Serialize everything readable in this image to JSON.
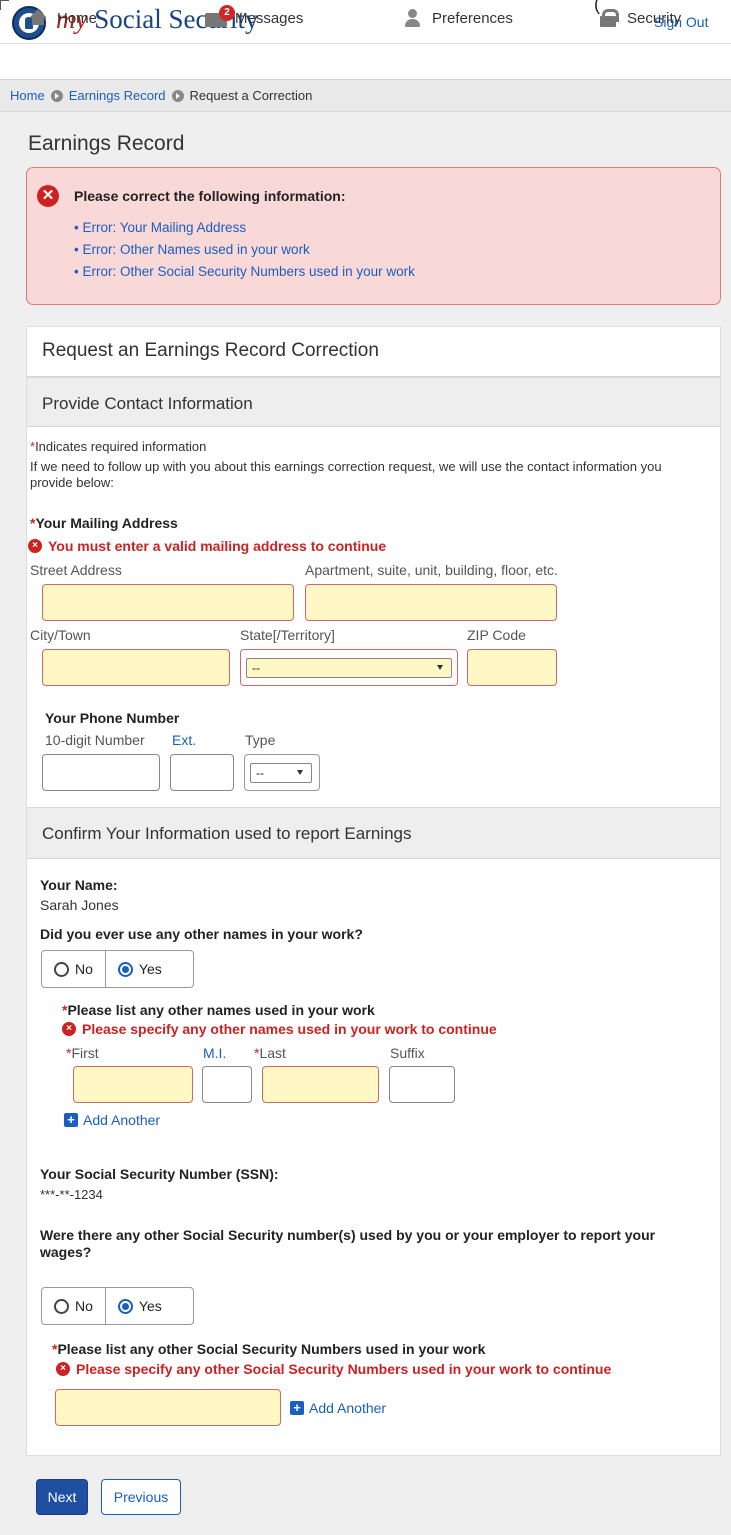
{
  "header": {
    "brand_my": "my",
    "brand_rest": " Social Security",
    "paren": "(",
    "sign_out": "Sign Out",
    "nav": {
      "home": "Home",
      "messages": "Messages",
      "messages_badge": "2",
      "preferences": "Preferences",
      "security": "Security"
    }
  },
  "breadcrumb": {
    "home": "Home",
    "earnings_record": "Earnings Record",
    "current": "Request a Correction"
  },
  "page_title": "Earnings Record",
  "error_summary": {
    "heading": "Please correct the following information:",
    "items": [
      "Error: Your Mailing Address",
      "Error: Other Names used in your work",
      "Error: Other Social Security Numbers used in your work"
    ]
  },
  "card": {
    "title": "Request an Earnings Record Correction",
    "contact_section": "Provide Contact Information",
    "required_note": "Indicates required information",
    "intro": "If we need to follow up with you about this earnings correction request, we will use the contact information you provide below:",
    "mailing": {
      "label": "Your Mailing Address",
      "error": "You must enter a valid mailing address to continue",
      "street_label": "Street Address",
      "apt_label": "Apartment, suite, unit, building, floor, etc.",
      "city_label": "City/Town",
      "state_label": "State[/Territory]",
      "state_value": "--",
      "zip_label": "ZIP Code"
    },
    "phone": {
      "label": "Your Phone Number",
      "number_label": "10-digit Number",
      "ext_label": "Ext.",
      "type_label": "Type",
      "type_value": "--"
    },
    "confirm_section": "Confirm Your Information used to report Earnings",
    "name": {
      "label": "Your Name:",
      "value": "Sarah Jones"
    },
    "other_names": {
      "question": "Did you ever use any other names in your work?",
      "no": "No",
      "yes": "Yes",
      "selected": "Yes",
      "list_label": "Please list any other names used in your work",
      "error": "Please specify any other names used in your work to continue",
      "first_label": "First",
      "mi_label": "M.I.",
      "last_label": "Last",
      "suffix_label": "Suffix",
      "add_another": "Add Another"
    },
    "ssn": {
      "label": "Your Social Security Number (SSN):",
      "value": "***-**-1234"
    },
    "other_ssn": {
      "question": "Were there any other Social Security number(s) used by you or your employer to report your wages?",
      "no": "No",
      "yes": "Yes",
      "selected": "Yes",
      "list_label": "Please list any other Social Security Numbers used in your work",
      "error": "Please specify any other Social Security Numbers used in your work to continue",
      "add_another": "Add Another"
    }
  },
  "buttons": {
    "next": "Next",
    "previous": "Previous"
  },
  "colors": {
    "link": "#1a5ec2",
    "error": "#cc2222",
    "error_bg": "#f9d8d8",
    "invalid_field_bg": "#fff8c4",
    "primary_button": "#1f4fa3"
  }
}
